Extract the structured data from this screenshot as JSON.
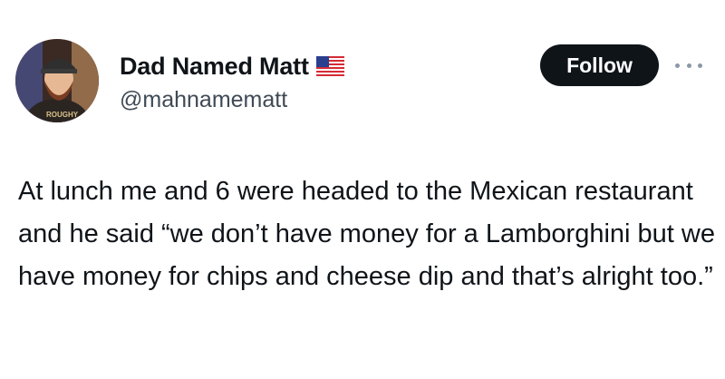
{
  "author": {
    "display_name": "Dad Named Matt",
    "handle": "@mahnamematt",
    "badge_icon": "us-flag-icon",
    "avatar_text": "ROUGHY"
  },
  "actions": {
    "follow_label": "Follow",
    "more_icon": "more-dots-icon"
  },
  "tweet": {
    "text": "At lunch me and 6 were headed to the Mexican restaurant and he said “we don’t have money for a Lamborghini but we have money for chips and cheese dip and that’s alright too.”"
  },
  "colors": {
    "follow_bg": "#0f1419",
    "text": "#0f1419",
    "handle": "#3f4a55",
    "more_dots": "#8b98a5"
  }
}
